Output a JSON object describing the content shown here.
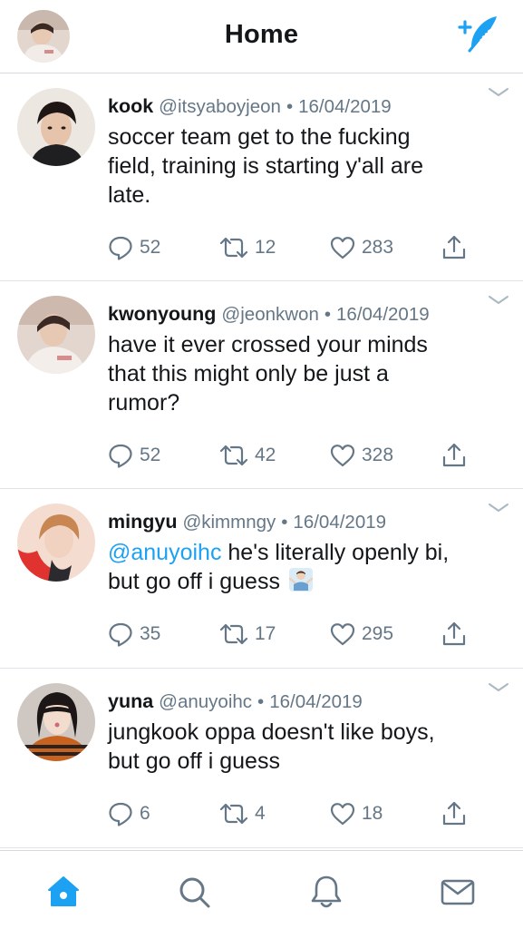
{
  "header": {
    "title": "Home"
  },
  "tweets": [
    {
      "name": "kook",
      "handle": "@itsyaboyjeon",
      "separator": "•",
      "date": "16/04/2019",
      "mention": "",
      "text_line1": "soccer team get to the fucking",
      "text_line2": "field, training is starting y'all are",
      "text_line3": "late.",
      "replies": "52",
      "retweets": "12",
      "likes": "283"
    },
    {
      "name": "kwonyoung",
      "handle": "@jeonkwon",
      "separator": "•",
      "date": "16/04/2019",
      "mention": "",
      "text_line1": "have it ever crossed your minds",
      "text_line2": "that this might only be just a",
      "text_line3": "rumor?",
      "replies": "52",
      "retweets": "42",
      "likes": "328"
    },
    {
      "name": "mingyu",
      "handle": "@kimmngy",
      "separator": "•",
      "date": "16/04/2019",
      "mention": "@anuyoihc",
      "text_line1": " he's literally openly bi,",
      "text_line2": "but go off i guess",
      "text_line3": "",
      "replies": "35",
      "retweets": "17",
      "likes": "295"
    },
    {
      "name": "yuna",
      "handle": "@anuyoihc",
      "separator": "•",
      "date": "16/04/2019",
      "mention": "",
      "text_line1": "jungkook oppa doesn't like boys,",
      "text_line2": "but go off i guess",
      "text_line3": "",
      "replies": "6",
      "retweets": "4",
      "likes": "18"
    }
  ],
  "icons": {
    "compose": "compose-feather-icon",
    "reply": "reply-bubble-icon",
    "retweet": "retweet-icon",
    "like": "heart-icon",
    "share": "share-icon",
    "chevron": "chevron-down-icon",
    "home": "home-icon",
    "search": "search-icon",
    "notifications": "bell-icon",
    "messages": "envelope-icon",
    "emoji": "person-shrugging-emoji"
  },
  "colors": {
    "accent": "#1da1f2",
    "text": "#14171a",
    "secondary": "#657786",
    "divider": "#dfe3e7"
  }
}
